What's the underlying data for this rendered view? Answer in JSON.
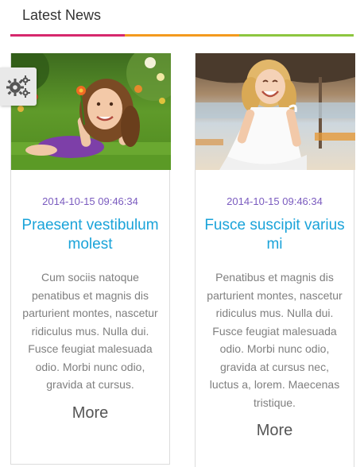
{
  "widget": {
    "title": "Latest News",
    "title_bar_colors": [
      "#d6286d",
      "#f39a1e",
      "#8dc63f"
    ],
    "settings_icon": "gears-icon"
  },
  "articles": [
    {
      "image": "girl-lying-in-grass-photo",
      "date": "2014-10-15 09:46:34",
      "title": "Praesent vestibulum molest",
      "excerpt": "Cum sociis natoque penatibus et magnis dis parturient montes, nascetur ridiculus mus. Nulla dui. Fusce feugiat malesuada odio. Morbi nunc odio, gravida at cursus.",
      "more_label": "More"
    },
    {
      "image": "girl-white-dress-beach-photo",
      "date": "2014-10-15 09:46:34",
      "title": "Fusce suscipit varius mi",
      "excerpt": "Penatibus et magnis dis parturient montes, nascetur ridiculus mus. Nulla dui. Fusce feugiat malesuada odio. Morbi nunc odio, gravida at cursus nec, luctus a, lorem. Maecenas tristique.",
      "more_label": "More"
    }
  ],
  "colors": {
    "date": "#7a5bbf",
    "headline": "#1aa3d9",
    "excerpt": "#7f7f7f",
    "more": "#555555"
  }
}
